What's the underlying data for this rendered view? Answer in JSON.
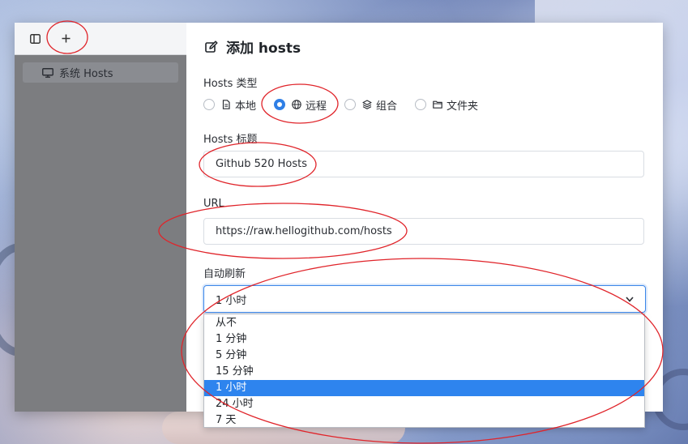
{
  "sidebar": {
    "items": [
      {
        "label": "系统 Hosts",
        "icon": "monitor-icon"
      }
    ]
  },
  "panel": {
    "title": "添加 hosts",
    "type_label": "Hosts 类型",
    "types": [
      {
        "label": "本地",
        "icon": "file-icon",
        "checked": false
      },
      {
        "label": "远程",
        "icon": "globe-icon",
        "checked": true
      },
      {
        "label": "组合",
        "icon": "layers-icon",
        "checked": false
      },
      {
        "label": "文件夹",
        "icon": "folder-icon",
        "checked": false
      }
    ],
    "title_label": "Hosts 标题",
    "title_value": "Github 520 Hosts",
    "url_label": "URL",
    "url_value": "https://raw.hellogithub.com/hosts",
    "refresh_label": "自动刷新",
    "refresh_value": "1 小时",
    "refresh_options": [
      "从不",
      "1 分钟",
      "5 分钟",
      "15 分钟",
      "1 小时",
      "24 小时",
      "7 天"
    ],
    "refresh_selected_index": 4
  },
  "colors": {
    "accent": "#2f7fe6",
    "annotation": "#e0242a"
  }
}
